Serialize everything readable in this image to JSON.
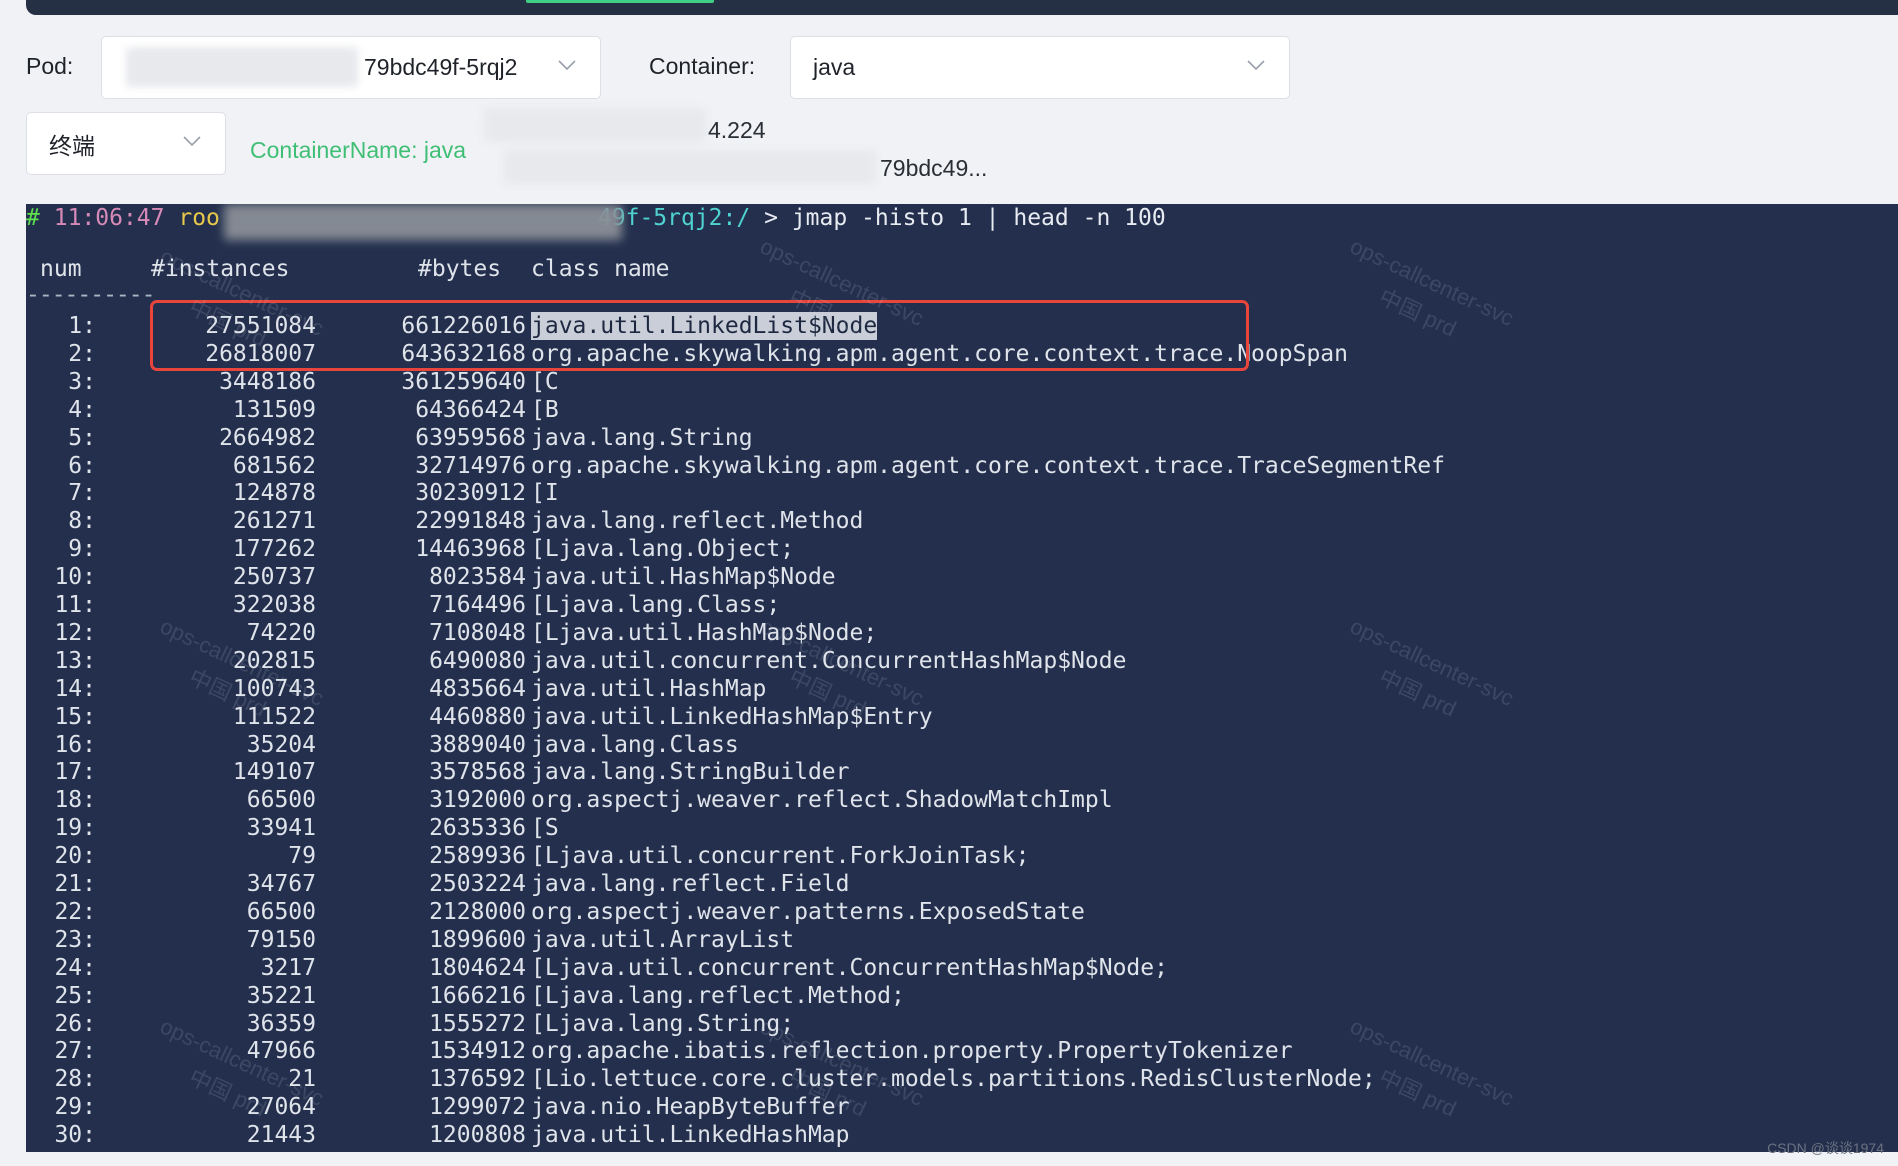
{
  "filters": {
    "pod_label": "Pod:",
    "pod_value": "79bdc49f-5rqj2",
    "container_label": "Container:",
    "container_value": "java",
    "mode_value": "终端"
  },
  "info": {
    "container_name": "ContainerName: java",
    "pod_ip_suffix": "4.224",
    "pod_name_suffix": "79bdc49..."
  },
  "terminal": {
    "prompt": {
      "hash": "#",
      "time": "11:06:47",
      "user": "roo",
      "host": "49f-5rqj2",
      "path": ":/",
      "arrow": ">",
      "command": "jmap -histo 1 | head -n 100"
    },
    "columns": [
      "num",
      "#instances",
      "#bytes",
      "class name"
    ],
    "separator": "----------",
    "rows": [
      {
        "num": "1:",
        "instances": "27551084",
        "bytes": "661226016",
        "class_name": "java.util.LinkedList$Node"
      },
      {
        "num": "2:",
        "instances": "26818007",
        "bytes": "643632168",
        "class_name": "org.apache.skywalking.apm.agent.core.context.trace.NoopSpan"
      },
      {
        "num": "3:",
        "instances": "3448186",
        "bytes": "361259640",
        "class_name": "[C"
      },
      {
        "num": "4:",
        "instances": "131509",
        "bytes": "64366424",
        "class_name": "[B"
      },
      {
        "num": "5:",
        "instances": "2664982",
        "bytes": "63959568",
        "class_name": "java.lang.String"
      },
      {
        "num": "6:",
        "instances": "681562",
        "bytes": "32714976",
        "class_name": "org.apache.skywalking.apm.agent.core.context.trace.TraceSegmentRef"
      },
      {
        "num": "7:",
        "instances": "124878",
        "bytes": "30230912",
        "class_name": "[I"
      },
      {
        "num": "8:",
        "instances": "261271",
        "bytes": "22991848",
        "class_name": "java.lang.reflect.Method"
      },
      {
        "num": "9:",
        "instances": "177262",
        "bytes": "14463968",
        "class_name": "[Ljava.lang.Object;"
      },
      {
        "num": "10:",
        "instances": "250737",
        "bytes": "8023584",
        "class_name": "java.util.HashMap$Node"
      },
      {
        "num": "11:",
        "instances": "322038",
        "bytes": "7164496",
        "class_name": "[Ljava.lang.Class;"
      },
      {
        "num": "12:",
        "instances": "74220",
        "bytes": "7108048",
        "class_name": "[Ljava.util.HashMap$Node;"
      },
      {
        "num": "13:",
        "instances": "202815",
        "bytes": "6490080",
        "class_name": "java.util.concurrent.ConcurrentHashMap$Node"
      },
      {
        "num": "14:",
        "instances": "100743",
        "bytes": "4835664",
        "class_name": "java.util.HashMap"
      },
      {
        "num": "15:",
        "instances": "111522",
        "bytes": "4460880",
        "class_name": "java.util.LinkedHashMap$Entry"
      },
      {
        "num": "16:",
        "instances": "35204",
        "bytes": "3889040",
        "class_name": "java.lang.Class"
      },
      {
        "num": "17:",
        "instances": "149107",
        "bytes": "3578568",
        "class_name": "java.lang.StringBuilder"
      },
      {
        "num": "18:",
        "instances": "66500",
        "bytes": "3192000",
        "class_name": "org.aspectj.weaver.reflect.ShadowMatchImpl"
      },
      {
        "num": "19:",
        "instances": "33941",
        "bytes": "2635336",
        "class_name": "[S"
      },
      {
        "num": "20:",
        "instances": "79",
        "bytes": "2589936",
        "class_name": "[Ljava.util.concurrent.ForkJoinTask;"
      },
      {
        "num": "21:",
        "instances": "34767",
        "bytes": "2503224",
        "class_name": "java.lang.reflect.Field"
      },
      {
        "num": "22:",
        "instances": "66500",
        "bytes": "2128000",
        "class_name": "org.aspectj.weaver.patterns.ExposedState"
      },
      {
        "num": "23:",
        "instances": "79150",
        "bytes": "1899600",
        "class_name": "java.util.ArrayList"
      },
      {
        "num": "24:",
        "instances": "3217",
        "bytes": "1804624",
        "class_name": "[Ljava.util.concurrent.ConcurrentHashMap$Node;"
      },
      {
        "num": "25:",
        "instances": "35221",
        "bytes": "1666216",
        "class_name": "[Ljava.lang.reflect.Method;"
      },
      {
        "num": "26:",
        "instances": "36359",
        "bytes": "1555272",
        "class_name": "[Ljava.lang.String;"
      },
      {
        "num": "27:",
        "instances": "47966",
        "bytes": "1534912",
        "class_name": "org.apache.ibatis.reflection.property.PropertyTokenizer"
      },
      {
        "num": "28:",
        "instances": "21",
        "bytes": "1376592",
        "class_name": "[Lio.lettuce.core.cluster.models.partitions.RedisClusterNode;"
      },
      {
        "num": "29:",
        "instances": "27064",
        "bytes": "1299072",
        "class_name": "java.nio.HeapByteBuffer"
      },
      {
        "num": "30:",
        "instances": "21443",
        "bytes": "1200808",
        "class_name": "java.util.LinkedHashMap"
      }
    ],
    "watermark_line1": "ops-callcenter-svc",
    "watermark_line2": "中国 prd"
  },
  "credit": "CSDN @谈谈1974",
  "colors": {
    "terminal_bg": "#232f4d",
    "accent_green": "#3fbf76",
    "highlight_red": "#e8453c"
  }
}
